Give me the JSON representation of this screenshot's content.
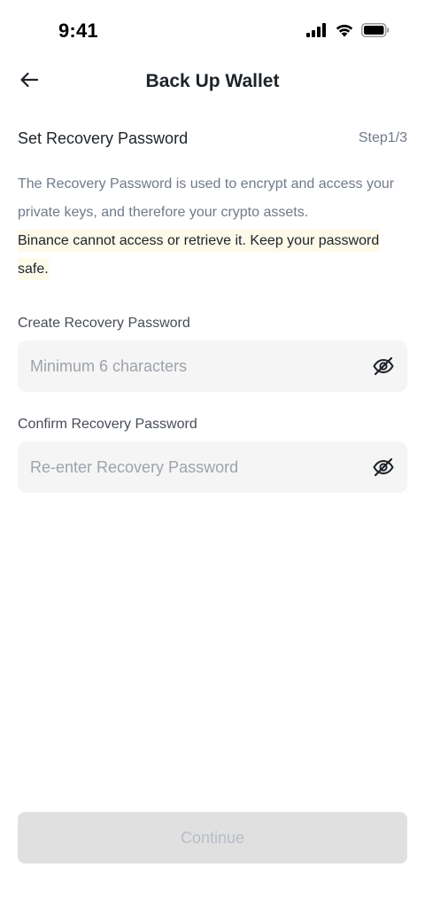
{
  "status_bar": {
    "time": "9:41",
    "icons": [
      "cellular-signal-icon",
      "wifi-icon",
      "battery-icon"
    ]
  },
  "header": {
    "back_icon": "arrow-left-icon",
    "title": "Back Up Wallet"
  },
  "section": {
    "title": "Set Recovery Password",
    "step": "Step1/3"
  },
  "description": {
    "text": "The Recovery Password is used to encrypt and access your private keys, and therefore your crypto assets.",
    "warning": "Binance cannot access or retrieve it. Keep your password safe."
  },
  "fields": {
    "create": {
      "label": "Create Recovery Password",
      "placeholder": "Minimum 6 characters",
      "value": "",
      "toggle_icon": "eye-off-icon"
    },
    "confirm": {
      "label": "Confirm Recovery Password",
      "placeholder": "Re-enter Recovery Password",
      "value": "",
      "toggle_icon": "eye-off-icon"
    }
  },
  "footer": {
    "continue_label": "Continue",
    "continue_enabled": false
  },
  "colors": {
    "text_primary": "#1e2329",
    "text_secondary": "#707a8a",
    "highlight": "#fdfaea",
    "input_bg": "#f5f5f5",
    "button_disabled_bg": "#e0e0e0",
    "button_disabled_text": "#b7bdc6"
  }
}
